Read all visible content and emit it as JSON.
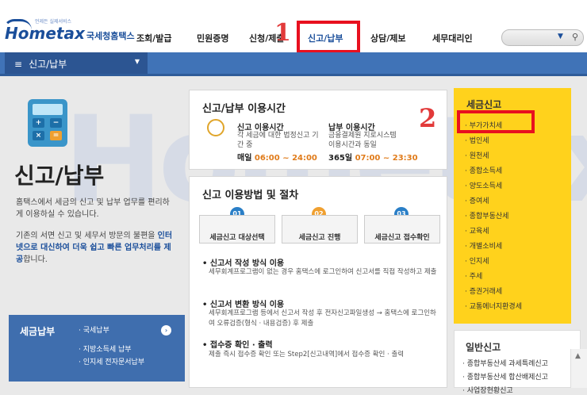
{
  "header": {
    "logo_main": "Hometax",
    "logo_ko": "국세청홈택스",
    "logo_tagline": "언제든 실제서비스",
    "nav": [
      "조회/발급",
      "민원증명",
      "신청/제출",
      "신고/납부",
      "상담/제보",
      "세무대리인"
    ],
    "annotation_1": "1",
    "search_placeholder": ""
  },
  "breadcrumb": {
    "label": "신고/납부"
  },
  "left": {
    "title": "신고/납부",
    "desc1": "홈택스에서 세금의 신고 및 납부 업무를 편리하게 이용하실 수 있습니다.",
    "desc2_a": "기존의 서면 신고 및 세무서 방문의 불편을",
    "desc2_b": "인터넷으로 대신하여 더욱 쉽고 빠른 업무처리를 제공",
    "desc2_c": "합니다.",
    "watermark": "Hometax",
    "pay": {
      "title": "세금납부",
      "items": [
        "국세납부",
        "지방소득세 납부",
        "인지세 전자문서납부"
      ],
      "more": "›"
    }
  },
  "hours": {
    "title": "신고/납부 이용시간",
    "left_head": "신고 이용시간",
    "left_desc": "각 세금에 대한 법정신고 기간 중",
    "left_label": "매일",
    "left_time": "06:00 ~ 24:00",
    "right_head": "납부 이용시간",
    "right_desc1": "금융결제원 지로시스템",
    "right_desc2": "이용시간과 동일",
    "right_label": "365일",
    "right_time": "07:00 ~ 23:30"
  },
  "annotation_2": "2",
  "method": {
    "title": "신고 이용방법 및 절차",
    "steps": [
      {
        "num": "01",
        "label": "세금신고 대상선택",
        "color": "#2a7fc7"
      },
      {
        "num": "02",
        "label": "세금신고 진행",
        "color": "#f0a030"
      },
      {
        "num": "03",
        "label": "세금신고 접수확인",
        "color": "#2a7fc7"
      }
    ],
    "items": [
      {
        "head": "신고서 작성 방식 이용",
        "desc": "세무회계프로그램이 없는 경우 홈택스에 로그인하여 신고서를 직접 작성하고 제출"
      },
      {
        "head": "신고서 변환 방식 이용",
        "desc": "세무회계프로그램 등에서 신고서 작성 후 전자신고파일생성 → 홈택스에 로그인하여 오류검증(형식 · 내용검증) 후 제출"
      },
      {
        "head": "접수증 확인 · 출력",
        "desc": "제출 즉시 접수증 확인 또는 Step2[신고내역]에서 접수증 확인 · 출력"
      }
    ]
  },
  "tax": {
    "head": "세금신고",
    "items": [
      "부가가치세",
      "법인세",
      "원천세",
      "종합소득세",
      "양도소득세",
      "증여세",
      "종합부동산세",
      "교육세",
      "개별소비세",
      "인지세",
      "주세",
      "증권거래세",
      "교통에너지환경세"
    ]
  },
  "general": {
    "head": "일반신고",
    "items": [
      "종합부동산세 과세특례신고",
      "종합부동산세 합산배제신고",
      "사업장현황신고"
    ]
  },
  "colors": {
    "brand": "#1a4e9a",
    "bar": "#4073b7",
    "tax_bg": "#ffd21c",
    "highlight": "#e8101f"
  }
}
